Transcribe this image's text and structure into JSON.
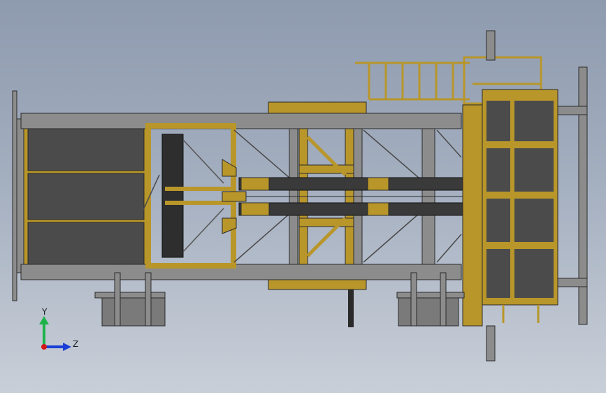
{
  "viewport": {
    "background_top": "#8e9aae",
    "background_bottom": "#c9cfd8"
  },
  "colors": {
    "steel_gray": "#8c8c8c",
    "panel_dark": "#4b4b4b",
    "frame_yellow": "#b8962a",
    "outline": "#2a2a2a"
  },
  "triad": {
    "y_label": "Y",
    "z_label": "Z",
    "y_color": "#1db34a",
    "z_color": "#1a3fd6",
    "origin_color": "#d01818"
  }
}
